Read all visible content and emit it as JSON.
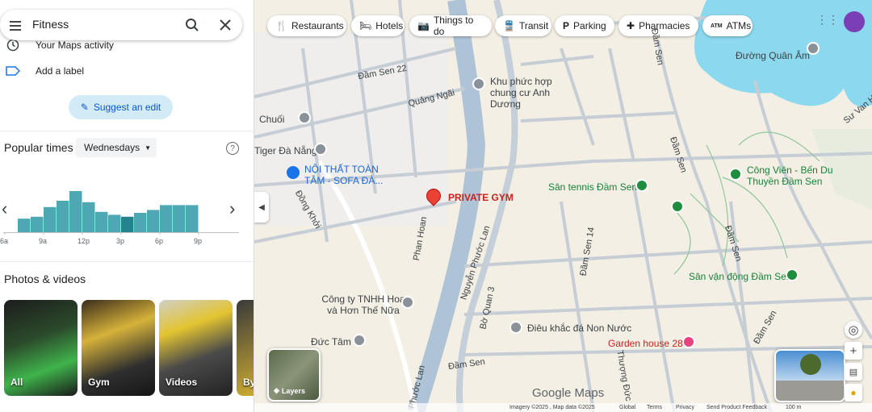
{
  "search": {
    "query": "Fitness"
  },
  "sidebar": {
    "activity_label": "Your Maps activity",
    "add_label": "Add a label",
    "suggest_edit": "Suggest an edit",
    "popular_times": {
      "title": "Popular times",
      "day": "Wednesdays",
      "hour_labels": [
        "6a",
        "9a",
        "12p",
        "3p",
        "6p",
        "9p"
      ],
      "bars": [
        0.28,
        0.32,
        0.52,
        0.65,
        0.85,
        0.62,
        0.42,
        0.36,
        0.32,
        0.4,
        0.46,
        0.56,
        0.56,
        0.56
      ],
      "highlight_index": 8
    },
    "photos": {
      "title": "Photos & videos",
      "items": [
        "All",
        "Gym",
        "Videos",
        "By"
      ]
    }
  },
  "chips": [
    "Restaurants",
    "Hotels",
    "Things to do",
    "Transit",
    "Parking",
    "Pharmacies",
    "ATMs"
  ],
  "map": {
    "places": [
      "Đường Quân Âm",
      "Khu phức hợp chung cư Anh Dương",
      "Tiger Đà Nẵng",
      "NỘI THẤT TOÀN TÂM - SOFA ĐÀ...",
      "Chuối",
      "PRIVATE GYM",
      "Sân tennis Đầm Sen",
      "Công Viên - Bến Du Thuyền Đầm Sen",
      "Sân vận động Đầm Sen",
      "Công ty TNHH Hoa và Hơn Thế Nữa",
      "Điêu khắc đá Non Nước",
      "Garden house 28",
      "Đức Tâm"
    ],
    "streets": [
      "Đầm Sen 22",
      "Quảng Ngãi",
      "Đồng Khởi",
      "Phan Hoan",
      "Nguyễn Phước Lan",
      "Bờ Quan 3",
      "Đầm Sen 14",
      "Đầm Sen",
      "Thượng Đức",
      "Sư Van H",
      "Phước Lan"
    ],
    "layers_label": "Layers",
    "logo": "Google Maps",
    "footer": {
      "imagery": "Imagery ©2025 , Map data ©2025",
      "global": "Global",
      "terms": "Terms",
      "privacy": "Privacy",
      "feedback": "Send Product Feedback",
      "scale": "100 m"
    }
  }
}
